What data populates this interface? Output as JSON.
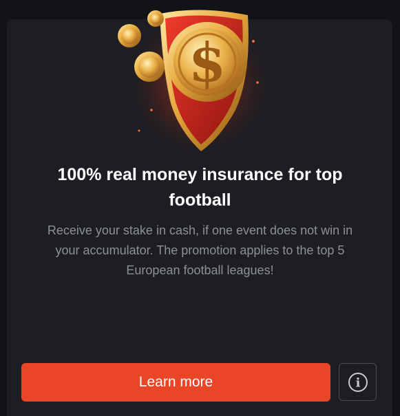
{
  "promo": {
    "title_lines": [
      "100% real money insurance for top",
      "football"
    ],
    "description_lines": [
      "Receive your stake in cash, if one event does not win in",
      "your accumulator. The promotion applies to the top 5",
      "European football leagues!"
    ],
    "hero_icon": "dollar-coin-shield-icon",
    "coin_symbol": "$"
  },
  "actions": {
    "learn_more_label": "Learn more",
    "info_icon": "info-icon",
    "info_symbol": "i"
  },
  "colors": {
    "background": "#111317",
    "card": "#1c1e23",
    "accent": "#e94628",
    "title": "#ffffff",
    "description": "#8d9097"
  }
}
